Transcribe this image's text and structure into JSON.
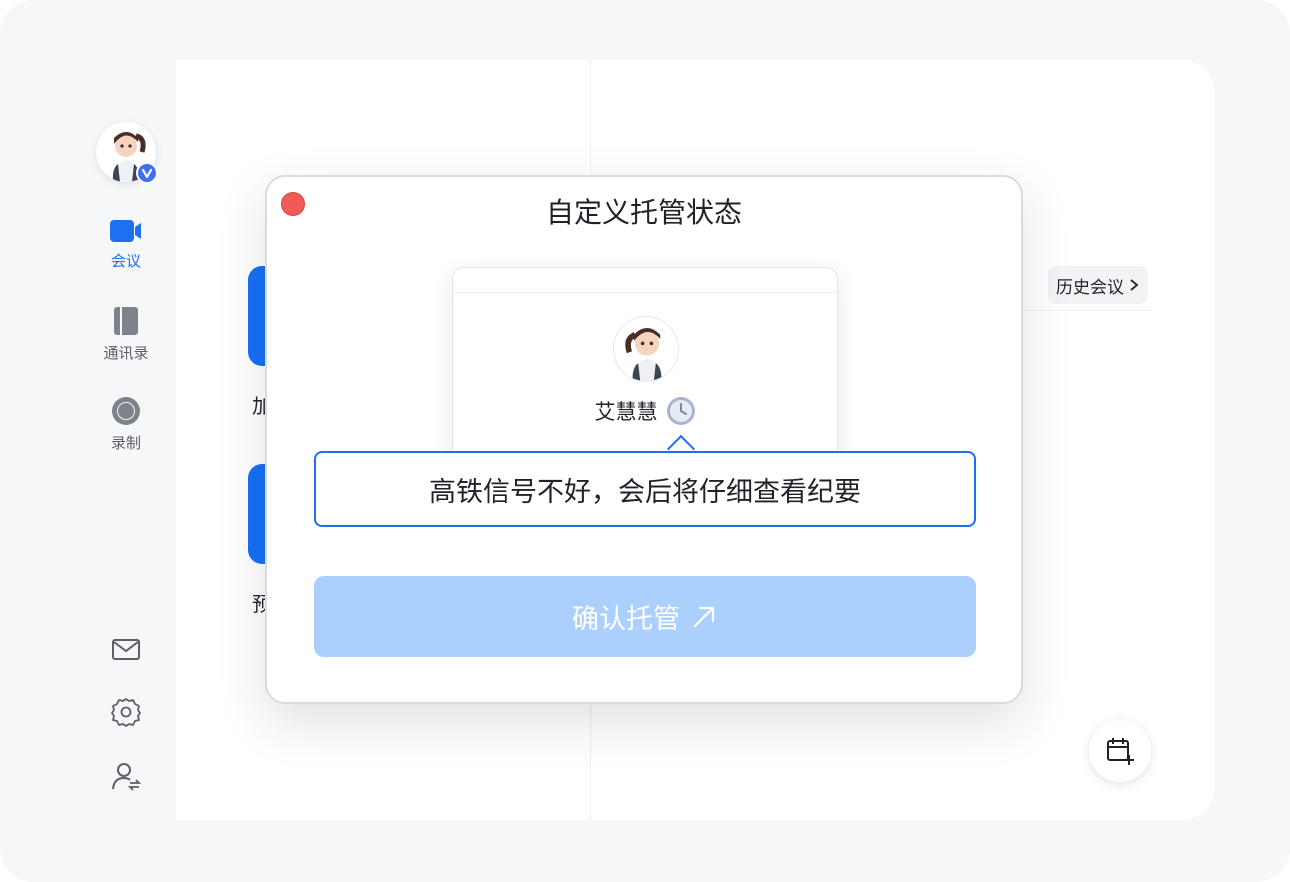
{
  "sidebar": {
    "items": [
      {
        "label": "会议",
        "icon": "video-camera-icon",
        "active": true
      },
      {
        "label": "通讯录",
        "icon": "book-icon",
        "active": false
      },
      {
        "label": "录制",
        "icon": "record-icon",
        "active": false
      }
    ],
    "bottom_icons": [
      "mail-icon",
      "gear-icon",
      "user-switch-icon"
    ]
  },
  "main": {
    "history_label": "历史会议",
    "tile_labels": [
      "加",
      "预"
    ]
  },
  "modal": {
    "title": "自定义托管状态",
    "user_name": "艾慧慧",
    "status_text": "高铁信号不好，会后将仔细查看纪要",
    "confirm_label": "确认托管"
  },
  "colors": {
    "accent": "#1f6ff2",
    "tile_blue": "#1670f5",
    "confirm_disabled": "#acd0fd",
    "close_red": "#f25a55"
  }
}
